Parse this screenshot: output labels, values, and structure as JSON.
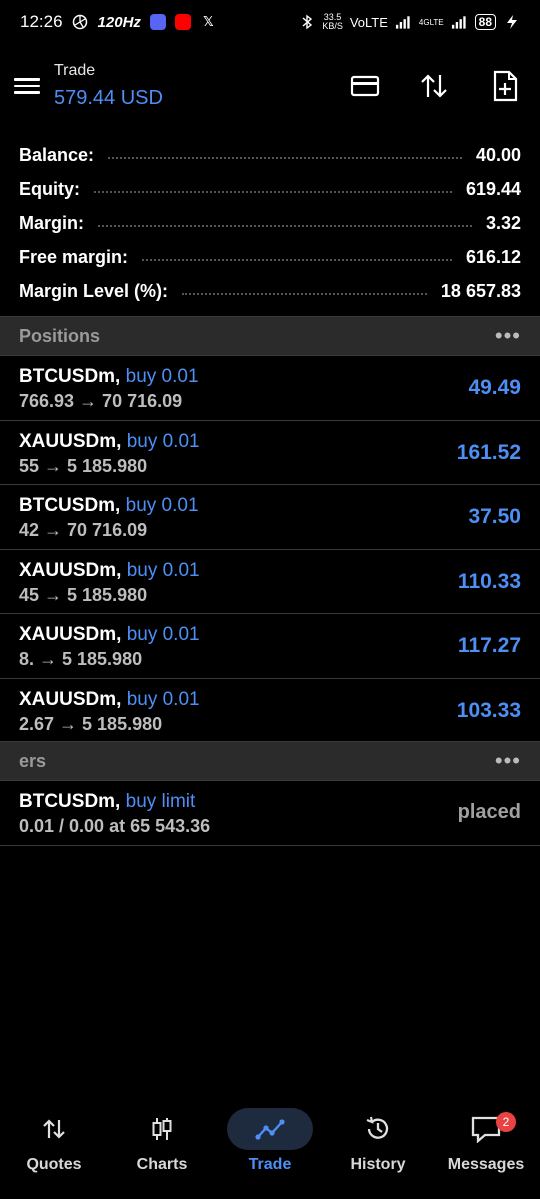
{
  "status_bar": {
    "time": "12:26",
    "refresh_rate": "120Hz",
    "net_speed_value": "33.5",
    "net_speed_unit": "KB/S",
    "volte": "VoLTE",
    "lte": "4GLTE",
    "battery": "88"
  },
  "header": {
    "title": "Trade",
    "balance": "579.44 USD"
  },
  "summary": [
    {
      "label": "Balance:",
      "value": "40.00"
    },
    {
      "label": "Equity:",
      "value": "619.44"
    },
    {
      "label": "Margin:",
      "value": "3.32"
    },
    {
      "label": "Free margin:",
      "value": "616.12"
    },
    {
      "label": "Margin Level (%):",
      "value": "18 657.83"
    }
  ],
  "positions": {
    "title": "Positions",
    "more": "•••",
    "rows": [
      {
        "symbol": "BTCUSDm,",
        "type": "buy 0.01",
        "prices": "766.93 → 70 716.09",
        "profit": "49.49"
      },
      {
        "symbol": "XAUUSDm,",
        "type": "buy 0.01",
        "prices": "55 → 5 185.980",
        "profit": "161.52"
      },
      {
        "symbol": "BTCUSDm,",
        "type": "buy 0.01",
        "prices": "42 → 70 716.09",
        "profit": "37.50"
      },
      {
        "symbol": "XAUUSDm,",
        "type": "buy 0.01",
        "prices": "45 → 5 185.980",
        "profit": "110.33"
      },
      {
        "symbol": "XAUUSDm,",
        "type": "buy 0.01",
        "prices": "8. → 5 185.980",
        "profit": "117.27"
      },
      {
        "symbol": "XAUUSDm,",
        "type": "buy 0.01",
        "prices": "2.67 → 5 185.980",
        "profit": "103.33"
      }
    ]
  },
  "orders": {
    "title": "ers",
    "more": "•••",
    "rows": [
      {
        "symbol": "BTCUSDm,",
        "type": "buy limit",
        "details": "0.01 / 0.00 at 65 543.36",
        "status": "placed"
      }
    ]
  },
  "nav": [
    {
      "label": "Quotes",
      "icon": "quotes-icon",
      "active": false
    },
    {
      "label": "Charts",
      "icon": "charts-icon",
      "active": false
    },
    {
      "label": "Trade",
      "icon": "trade-icon",
      "active": true
    },
    {
      "label": "History",
      "icon": "history-icon",
      "active": false
    },
    {
      "label": "Messages",
      "icon": "messages-icon",
      "active": false,
      "badge": "2"
    }
  ],
  "colors": {
    "accent": "#4d8ff5",
    "background": "#000000",
    "section_bg": "#2b2b2b",
    "badge": "#e94242"
  }
}
